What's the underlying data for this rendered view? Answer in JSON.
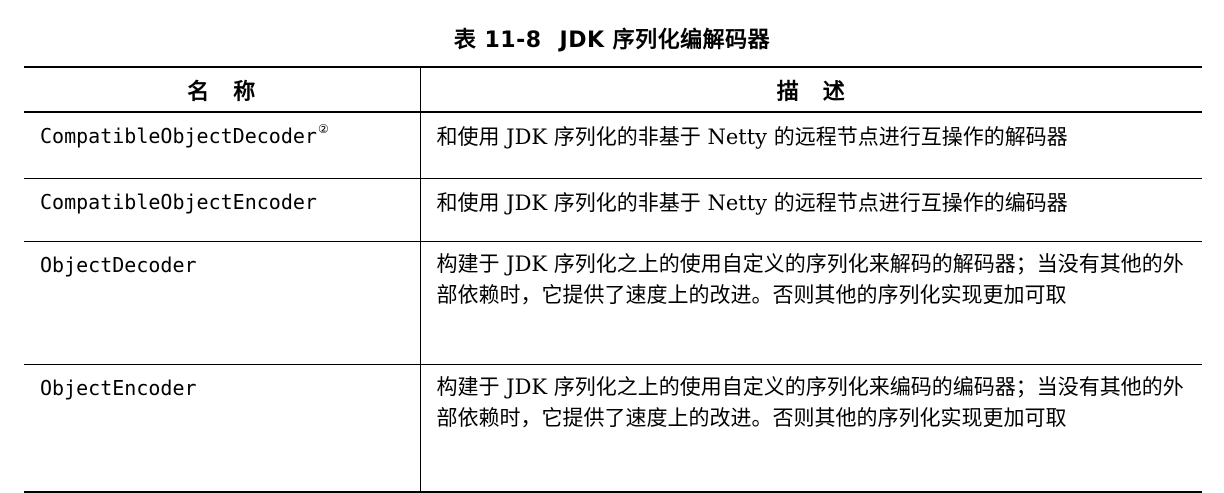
{
  "caption": {
    "number": "表 11-8",
    "title": "JDK 序列化编解码器"
  },
  "table": {
    "headers": {
      "name": "名　称",
      "description": "描　述"
    },
    "rows": [
      {
        "name": "CompatibleObjectDecoder",
        "footnote": "②",
        "description": "和使用 JDK 序列化的非基于 Netty 的远程节点进行互操作的解码器"
      },
      {
        "name": "CompatibleObjectEncoder",
        "footnote": "",
        "description": "和使用 JDK 序列化的非基于 Netty 的远程节点进行互操作的编码器"
      },
      {
        "name": "ObjectDecoder",
        "footnote": "",
        "description": "构建于 JDK 序列化之上的使用自定义的序列化来解码的解码器；当没有其他的外部依赖时，它提供了速度上的改进。否则其他的序列化实现更加可取"
      },
      {
        "name": "ObjectEncoder",
        "footnote": "",
        "description": "构建于 JDK 序列化之上的使用自定义的序列化来编码的编码器；当没有其他的外部依赖时，它提供了速度上的改进。否则其他的序列化实现更加可取"
      }
    ]
  }
}
